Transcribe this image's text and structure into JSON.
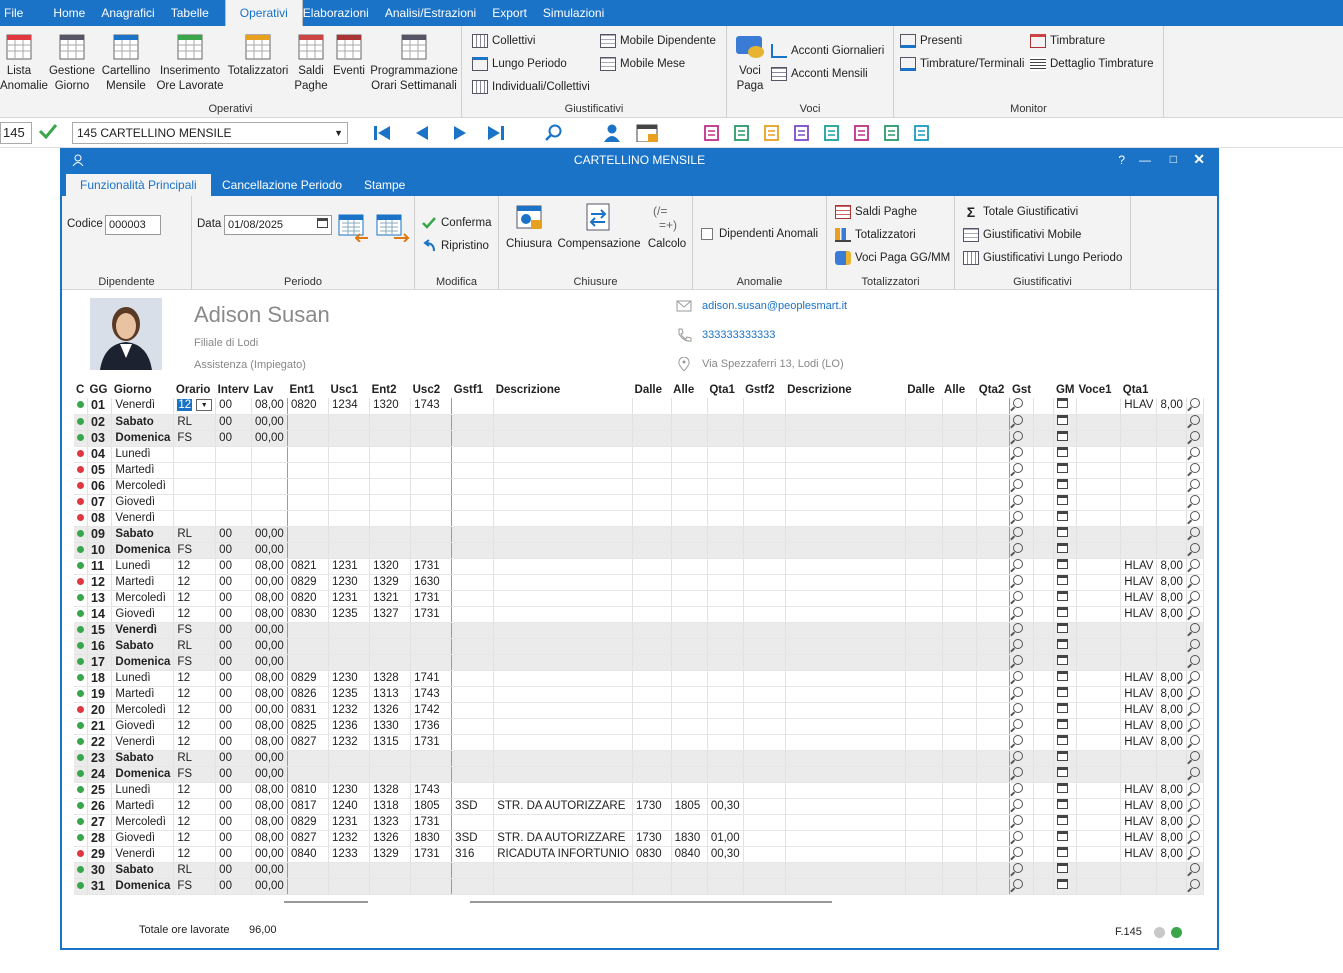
{
  "menu": {
    "items": [
      "File",
      "Home",
      "Anagrafici",
      "Tabelle",
      "Operativi",
      "Elaborazioni",
      "Analisi/Estrazioni",
      "Export",
      "Simulazioni"
    ],
    "active": "Operativi"
  },
  "ribbon": {
    "operativi": {
      "label": "Operativi",
      "buttons": [
        "Lista\nAnomalie",
        "Gestione\nGiorno",
        "Cartellino\nMensile",
        "Inserimento\nOre Lavorate",
        "Totalizzatori",
        "Saldi\nPaghe",
        "Eventi",
        "Programmazione\nOrari Settimanali"
      ]
    },
    "giustificativi": {
      "label": "Giustificativi",
      "items": [
        "Collettivi",
        "Lungo Periodo",
        "Individuali/Collettivi",
        "Mobile Dipendente",
        "Mobile Mese"
      ]
    },
    "voci": {
      "label": "Voci",
      "big": "Voci\nPaga",
      "items": [
        "Acconti Giornalieri",
        "Acconti Mensili"
      ]
    },
    "monitor": {
      "label": "Monitor",
      "items": [
        "Presenti",
        "Timbrature/Terminali",
        "Timbrature",
        "Dettaglio Timbrature"
      ]
    }
  },
  "toolbar": {
    "code": "145",
    "combo": "145 CARTELLINO MENSILE"
  },
  "window": {
    "title": "CARTELLINO MENSILE",
    "tabs": [
      "Funzionalità Principali",
      "Cancellazione Periodo",
      "Stampe"
    ]
  },
  "wribbon": {
    "dipendente": {
      "label": "Dipendente",
      "codice_label": "Codice",
      "codice": "000003"
    },
    "periodo": {
      "label": "Periodo",
      "data_label": "Data",
      "data": "01/08/2025"
    },
    "modifica": {
      "label": "Modifica",
      "conferma": "Conferma",
      "ripristino": "Ripristino"
    },
    "chiusure": {
      "label": "Chiusure",
      "chiusura": "Chiusura",
      "compensazione": "Compensazione",
      "calcolo": "Calcolo"
    },
    "anomalie": {
      "label": "Anomalie",
      "check": "Dipendenti Anomali"
    },
    "totalizzatori": {
      "label": "Totalizzatori",
      "items": [
        "Saldi Paghe",
        "Totalizzatori",
        "Voci Paga GG/MM"
      ]
    },
    "giustificativi": {
      "label": "Giustificativi",
      "items": [
        "Totale Giustificativi",
        "Giustificativi Mobile",
        "Giustificativi Lungo Periodo"
      ]
    }
  },
  "profile": {
    "name": "Adison Susan",
    "filiale": "Filiale di Lodi",
    "ruolo": "Assistenza (Impiegato)",
    "email": "adison.susan@peoplesmart.it",
    "phone": "333333333333",
    "address": "Via Spezzaferri 13, Lodi (LO)"
  },
  "grid": {
    "headers": [
      "C",
      "GG",
      "Giorno",
      "Orario",
      "Interv",
      "Lav",
      "Ent1",
      "Usc1",
      "Ent2",
      "Usc2",
      "Gstf1",
      "Descrizione",
      "Dalle",
      "Alle",
      "Qta1",
      "Gstf2",
      "Descrizione",
      "Dalle",
      "Alle",
      "Qta2",
      "Gst",
      "GM",
      "Voce1",
      "Qta1"
    ],
    "rows": [
      {
        "c": "g",
        "gg": "01",
        "day": "Venerdì",
        "orario": "12",
        "interv": "00",
        "lav": "08,00",
        "ent1": "0820",
        "usc1": "1234",
        "ent2": "1320",
        "usc2": "1743",
        "gstf1": "",
        "desc1": "",
        "dalle": "",
        "alle": "",
        "qta1": "",
        "voce1": "HLAV",
        "vqta1": "8,00",
        "we": false
      },
      {
        "c": "g",
        "gg": "02",
        "day": "Sabato",
        "orario": "RL",
        "interv": "00",
        "lav": "00,00",
        "we": true
      },
      {
        "c": "g",
        "gg": "03",
        "day": "Domenica",
        "orario": "FS",
        "interv": "00",
        "lav": "00,00",
        "we": true
      },
      {
        "c": "r",
        "gg": "04",
        "day": "Lunedì",
        "we": false
      },
      {
        "c": "r",
        "gg": "05",
        "day": "Martedì",
        "we": false
      },
      {
        "c": "r",
        "gg": "06",
        "day": "Mercoledì",
        "we": false
      },
      {
        "c": "r",
        "gg": "07",
        "day": "Giovedì",
        "we": false
      },
      {
        "c": "r",
        "gg": "08",
        "day": "Venerdì",
        "we": false
      },
      {
        "c": "g",
        "gg": "09",
        "day": "Sabato",
        "orario": "RL",
        "interv": "00",
        "lav": "00,00",
        "we": true
      },
      {
        "c": "g",
        "gg": "10",
        "day": "Domenica",
        "orario": "FS",
        "interv": "00",
        "lav": "00,00",
        "we": true
      },
      {
        "c": "g",
        "gg": "11",
        "day": "Lunedì",
        "orario": "12",
        "interv": "00",
        "lav": "08,00",
        "ent1": "0821",
        "usc1": "1231",
        "ent2": "1320",
        "usc2": "1731",
        "voce1": "HLAV",
        "vqta1": "8,00",
        "we": false
      },
      {
        "c": "r",
        "gg": "12",
        "day": "Martedì",
        "orario": "12",
        "interv": "00",
        "lav": "00,00",
        "ent1": "0829",
        "usc1": "1230",
        "ent2": "1329",
        "usc2": "1630",
        "voce1": "HLAV",
        "vqta1": "8,00",
        "we": false
      },
      {
        "c": "g",
        "gg": "13",
        "day": "Mercoledì",
        "orario": "12",
        "interv": "00",
        "lav": "08,00",
        "ent1": "0820",
        "usc1": "1231",
        "ent2": "1321",
        "usc2": "1731",
        "voce1": "HLAV",
        "vqta1": "8,00",
        "we": false
      },
      {
        "c": "g",
        "gg": "14",
        "day": "Giovedì",
        "orario": "12",
        "interv": "00",
        "lav": "08,00",
        "ent1": "0830",
        "usc1": "1235",
        "ent2": "1327",
        "usc2": "1731",
        "voce1": "HLAV",
        "vqta1": "8,00",
        "we": false
      },
      {
        "c": "g",
        "gg": "15",
        "day": "Venerdì",
        "orario": "FS",
        "interv": "00",
        "lav": "00,00",
        "we": true
      },
      {
        "c": "g",
        "gg": "16",
        "day": "Sabato",
        "orario": "RL",
        "interv": "00",
        "lav": "00,00",
        "we": true
      },
      {
        "c": "g",
        "gg": "17",
        "day": "Domenica",
        "orario": "FS",
        "interv": "00",
        "lav": "00,00",
        "we": true
      },
      {
        "c": "g",
        "gg": "18",
        "day": "Lunedì",
        "orario": "12",
        "interv": "00",
        "lav": "08,00",
        "ent1": "0829",
        "usc1": "1230",
        "ent2": "1328",
        "usc2": "1741",
        "voce1": "HLAV",
        "vqta1": "8,00",
        "we": false
      },
      {
        "c": "g",
        "gg": "19",
        "day": "Martedì",
        "orario": "12",
        "interv": "00",
        "lav": "08,00",
        "ent1": "0826",
        "usc1": "1235",
        "ent2": "1313",
        "usc2": "1743",
        "voce1": "HLAV",
        "vqta1": "8,00",
        "we": false
      },
      {
        "c": "r",
        "gg": "20",
        "day": "Mercoledì",
        "orario": "12",
        "interv": "00",
        "lav": "00,00",
        "ent1": "0831",
        "usc1": "1232",
        "ent2": "1326",
        "usc2": "1742",
        "voce1": "HLAV",
        "vqta1": "8,00",
        "we": false
      },
      {
        "c": "g",
        "gg": "21",
        "day": "Giovedì",
        "orario": "12",
        "interv": "00",
        "lav": "08,00",
        "ent1": "0825",
        "usc1": "1236",
        "ent2": "1330",
        "usc2": "1736",
        "voce1": "HLAV",
        "vqta1": "8,00",
        "we": false
      },
      {
        "c": "g",
        "gg": "22",
        "day": "Venerdì",
        "orario": "12",
        "interv": "00",
        "lav": "08,00",
        "ent1": "0827",
        "usc1": "1232",
        "ent2": "1315",
        "usc2": "1731",
        "voce1": "HLAV",
        "vqta1": "8,00",
        "we": false
      },
      {
        "c": "g",
        "gg": "23",
        "day": "Sabato",
        "orario": "RL",
        "interv": "00",
        "lav": "00,00",
        "we": true
      },
      {
        "c": "g",
        "gg": "24",
        "day": "Domenica",
        "orario": "FS",
        "interv": "00",
        "lav": "00,00",
        "we": true
      },
      {
        "c": "g",
        "gg": "25",
        "day": "Lunedì",
        "orario": "12",
        "interv": "00",
        "lav": "08,00",
        "ent1": "0810",
        "usc1": "1230",
        "ent2": "1328",
        "usc2": "1743",
        "voce1": "HLAV",
        "vqta1": "8,00",
        "we": false
      },
      {
        "c": "g",
        "gg": "26",
        "day": "Martedì",
        "orario": "12",
        "interv": "00",
        "lav": "08,00",
        "ent1": "0817",
        "usc1": "1240",
        "ent2": "1318",
        "usc2": "1805",
        "gstf1": "3SD",
        "desc1": "STR. DA AUTORIZZARE",
        "dalle": "1730",
        "alle": "1805",
        "qta1": "00,30",
        "voce1": "HLAV",
        "vqta1": "8,00",
        "we": false
      },
      {
        "c": "g",
        "gg": "27",
        "day": "Mercoledì",
        "orario": "12",
        "interv": "00",
        "lav": "08,00",
        "ent1": "0829",
        "usc1": "1231",
        "ent2": "1323",
        "usc2": "1731",
        "voce1": "HLAV",
        "vqta1": "8,00",
        "we": false
      },
      {
        "c": "g",
        "gg": "28",
        "day": "Giovedì",
        "orario": "12",
        "interv": "00",
        "lav": "08,00",
        "ent1": "0827",
        "usc1": "1232",
        "ent2": "1326",
        "usc2": "1830",
        "gstf1": "3SD",
        "desc1": "STR. DA AUTORIZZARE",
        "dalle": "1730",
        "alle": "1830",
        "qta1": "01,00",
        "voce1": "HLAV",
        "vqta1": "8,00",
        "we": false
      },
      {
        "c": "r",
        "gg": "29",
        "day": "Venerdì",
        "orario": "12",
        "interv": "00",
        "lav": "00,00",
        "ent1": "0840",
        "usc1": "1233",
        "ent2": "1329",
        "usc2": "1731",
        "gstf1": "316",
        "desc1": "RICADUTA INFORTUNIO",
        "dalle": "0830",
        "alle": "0840",
        "qta1": "00,30",
        "voce1": "HLAV",
        "vqta1": "8,00",
        "we": false
      },
      {
        "c": "g",
        "gg": "30",
        "day": "Sabato",
        "orario": "RL",
        "interv": "00",
        "lav": "00,00",
        "we": true
      },
      {
        "c": "g",
        "gg": "31",
        "day": "Domenica",
        "orario": "FS",
        "interv": "00",
        "lav": "00,00",
        "we": true
      }
    ]
  },
  "footer": {
    "totale_label": "Totale ore lavorate",
    "totale": "96,00",
    "code": "F.145"
  }
}
